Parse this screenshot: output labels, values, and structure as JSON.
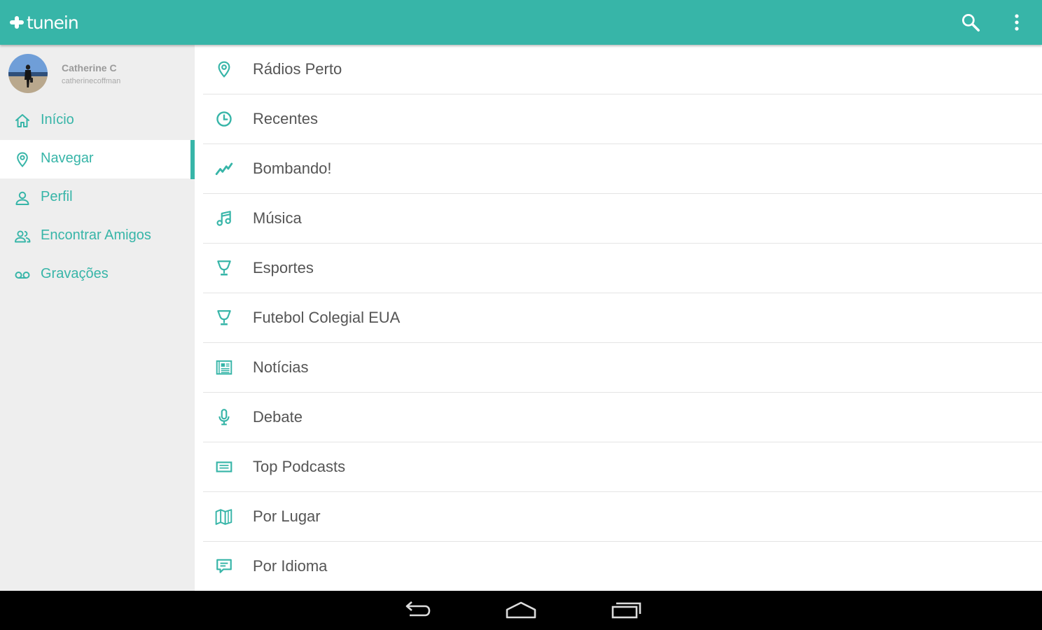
{
  "app": {
    "logo_text": "tunein",
    "logo_text_main": "tune",
    "logo_text_suffix": "in",
    "accent_color": "#37b5a8",
    "header_icons": [
      "search-icon",
      "more-vert-icon"
    ]
  },
  "profile": {
    "name": "Catherine C",
    "username": "catherinecoffman"
  },
  "sidebar": {
    "active_index": 1,
    "items": [
      {
        "label": "Início",
        "icon": "home-icon"
      },
      {
        "label": "Navegar",
        "icon": "location-pin-icon"
      },
      {
        "label": "Perfil",
        "icon": "person-icon"
      },
      {
        "label": "Encontrar Amigos",
        "icon": "people-icon"
      },
      {
        "label": "Gravações",
        "icon": "voicemail-icon"
      }
    ]
  },
  "categories": [
    {
      "label": "Rádios Perto",
      "icon": "location-pin-icon"
    },
    {
      "label": "Recentes",
      "icon": "clock-icon"
    },
    {
      "label": "Bombando!",
      "icon": "trending-icon"
    },
    {
      "label": "Música",
      "icon": "music-note-icon"
    },
    {
      "label": "Esportes",
      "icon": "trophy-icon"
    },
    {
      "label": "Futebol Colegial EUA",
      "icon": "trophy-icon"
    },
    {
      "label": "Notícias",
      "icon": "newspaper-icon"
    },
    {
      "label": "Debate",
      "icon": "microphone-icon"
    },
    {
      "label": "Top Podcasts",
      "icon": "podcast-list-icon"
    },
    {
      "label": "Por Lugar",
      "icon": "map-icon"
    },
    {
      "label": "Por Idioma",
      "icon": "chat-bubble-icon"
    }
  ],
  "system_nav": [
    "back-icon",
    "home-outline-icon",
    "recent-apps-icon"
  ]
}
